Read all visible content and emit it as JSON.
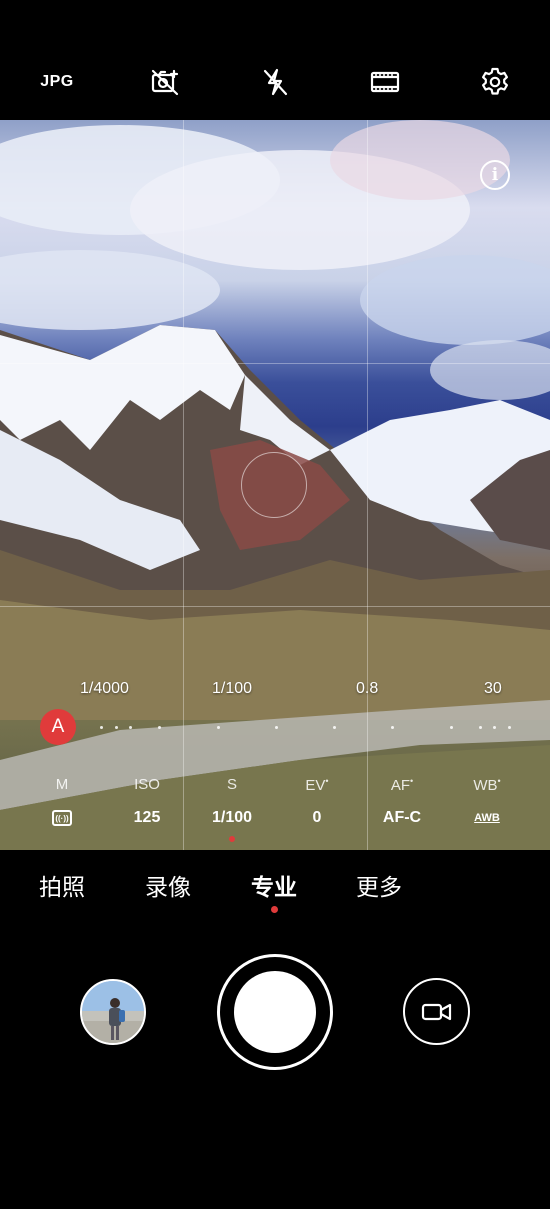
{
  "topbar": {
    "format_label": "JPG",
    "icons": [
      "no-live-photo-icon",
      "flash-off-icon",
      "aspect-ratio-film-icon",
      "gear-icon"
    ]
  },
  "viewfinder": {
    "info_icon": "info-icon",
    "shutter_scale": {
      "labels": [
        "1/4000",
        "1/100",
        "0.8",
        "30"
      ],
      "auto_label": "A"
    },
    "params": [
      {
        "name": "M",
        "value": "",
        "icon": "metering-icon"
      },
      {
        "name": "ISO",
        "value": "125"
      },
      {
        "name": "S",
        "value": "1/100"
      },
      {
        "name": "EV",
        "value": "0"
      },
      {
        "name": "AF",
        "value": "AF-C"
      },
      {
        "name": "WB",
        "value": "AWB"
      }
    ],
    "selected_param": "S"
  },
  "modes": {
    "items": [
      "拍照",
      "录像",
      "专业",
      "更多"
    ],
    "active": "专业"
  },
  "controls": {
    "gallery_icon": "gallery-thumbnail",
    "shutter_icon": "shutter-button",
    "video_icon": "video-camera-icon"
  },
  "colors": {
    "accent": "#e03b3b",
    "background": "#000000"
  }
}
